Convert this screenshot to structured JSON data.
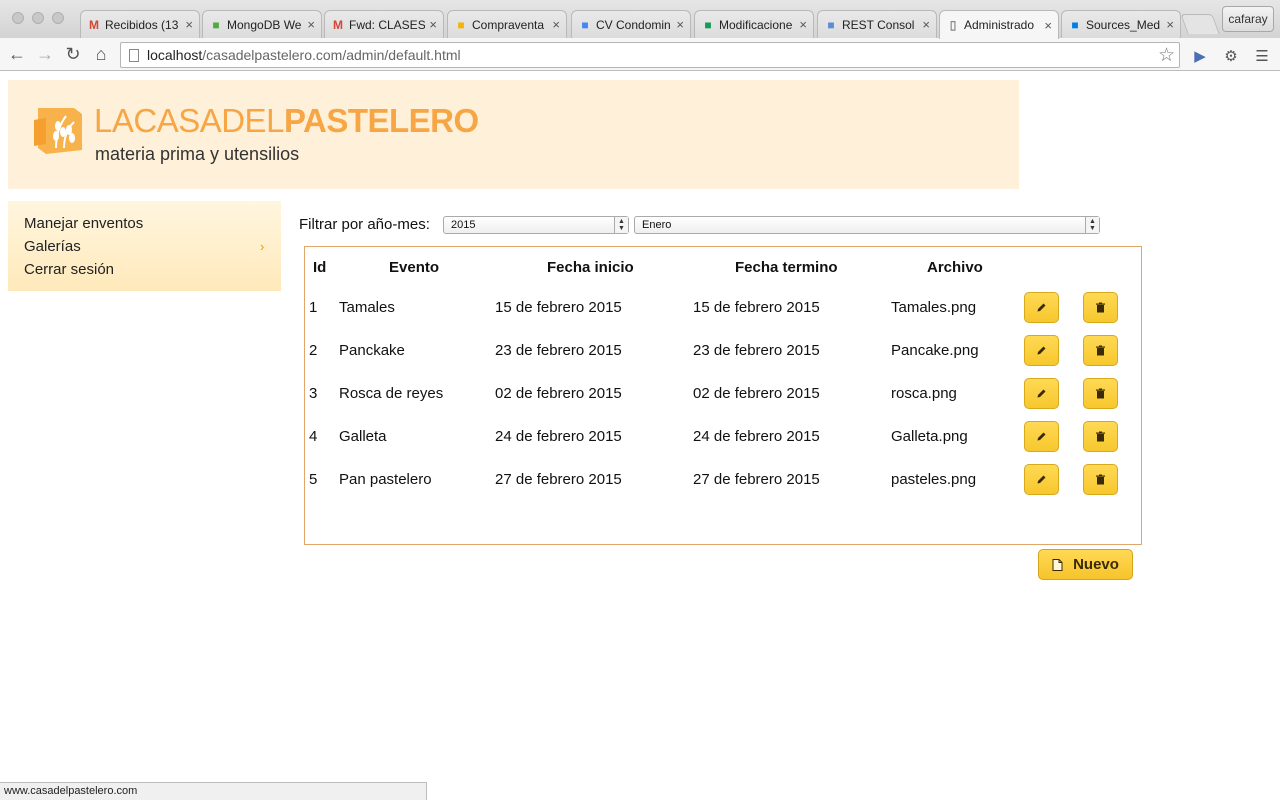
{
  "browser": {
    "tabs": [
      {
        "label": "Recibidos (13",
        "icon": "gmail-icon",
        "color": "#d44638"
      },
      {
        "label": "MongoDB We",
        "icon": "mongodb-leaf-icon",
        "color": "#4faa41"
      },
      {
        "label": "Fwd: CLASES",
        "icon": "gmail-icon",
        "color": "#d44638"
      },
      {
        "label": "Compraventa",
        "icon": "drive-icon",
        "color": "#f4b400"
      },
      {
        "label": "CV Condomin",
        "icon": "docs-icon",
        "color": "#4285f4"
      },
      {
        "label": "Modificacione",
        "icon": "sheets-icon",
        "color": "#0f9d58"
      },
      {
        "label": "REST Consol",
        "icon": "rest-console-icon",
        "color": "#5b8dd6"
      },
      {
        "label": "Administrado",
        "icon": "page-icon",
        "color": "#888888"
      },
      {
        "label": "Sources_Med",
        "icon": "dropbox-icon",
        "color": "#007ee5"
      }
    ],
    "profile": "cafaray",
    "url_host": "localhost",
    "url_path": "/casadelpastelero.com/admin/default.html",
    "status_url": "www.casadelpastelero.com"
  },
  "brand": {
    "name_part1": "LACASADEL",
    "name_part2": "PASTELERO",
    "tagline": "materia prima y utensilios",
    "color": "#f6a645"
  },
  "sidebar": {
    "items": [
      {
        "label": "Manejar enventos"
      },
      {
        "label": "Galerías"
      },
      {
        "label": "Cerrar sesión"
      }
    ]
  },
  "filter": {
    "label": "Filtrar por año-mes:",
    "year": "2015",
    "month": "Enero"
  },
  "table": {
    "headers": [
      "Id",
      "Evento",
      "Fecha inicio",
      "Fecha termino",
      "Archivo"
    ],
    "rows": [
      {
        "id": "1",
        "evento": "Tamales",
        "inicio": "15 de febrero 2015",
        "termino": "15 de febrero 2015",
        "archivo": "Tamales.png"
      },
      {
        "id": "2",
        "evento": "Panckake",
        "inicio": "23 de febrero 2015",
        "termino": "23 de febrero 2015",
        "archivo": "Pancake.png"
      },
      {
        "id": "3",
        "evento": "Rosca de reyes",
        "inicio": "02 de febrero 2015",
        "termino": "02 de febrero 2015",
        "archivo": "rosca.png"
      },
      {
        "id": "4",
        "evento": "Galleta",
        "inicio": "24 de febrero 2015",
        "termino": "24 de febrero 2015",
        "archivo": "Galleta.png"
      },
      {
        "id": "5",
        "evento": "Pan pastelero",
        "inicio": "27 de febrero 2015",
        "termino": "27 de febrero 2015",
        "archivo": "pasteles.png"
      }
    ]
  },
  "actions": {
    "new_label": "Nuevo"
  },
  "colors": {
    "accent": "#f7c72d",
    "banner_bg": "#fff1d9",
    "table_border": "#e0a66a"
  }
}
